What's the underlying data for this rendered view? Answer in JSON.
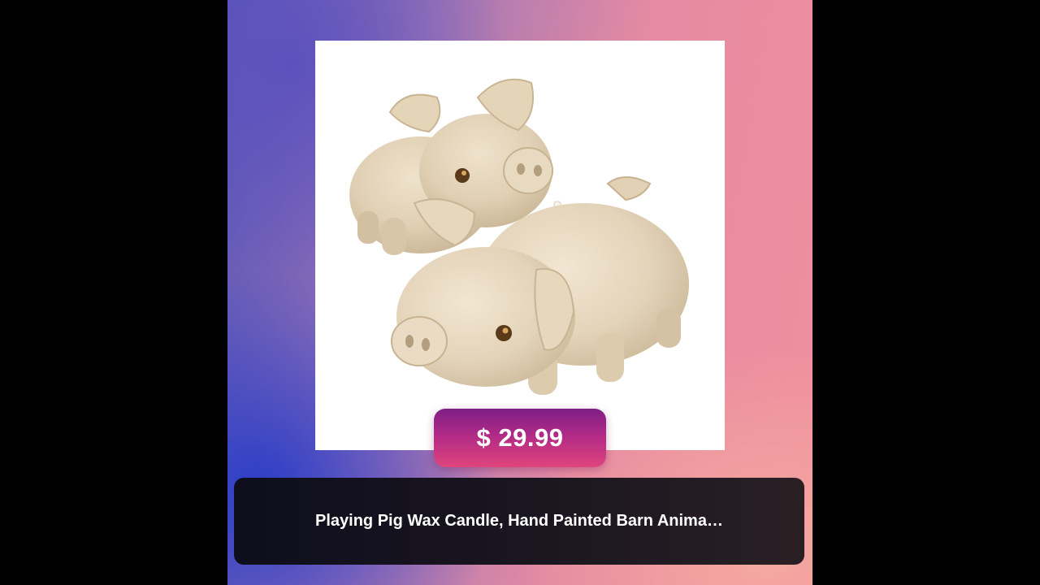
{
  "product": {
    "image_subject": "two-pig-wax-candle-figurine",
    "price": "$ 29.99",
    "title": "Playing Pig Wax Candle, Hand Painted Barn Anima…"
  },
  "colors": {
    "background_outer": "#000000",
    "gradient_left": "#5a57b7",
    "gradient_right": "#f0909e",
    "badge_top": "#7d1f87",
    "badge_bottom": "#e0457c",
    "title_bar": "#161420",
    "text": "#ffffff"
  }
}
